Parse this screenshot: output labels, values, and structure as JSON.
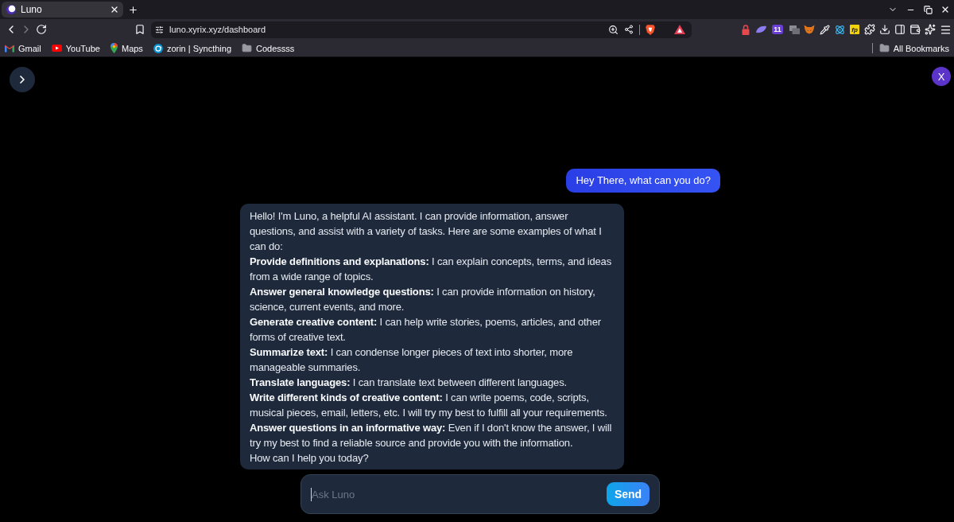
{
  "browser": {
    "tabs": [
      {
        "title": "Luno",
        "selected": true
      }
    ],
    "address": "luno.xyrix.xyz/dashboard",
    "extension_count": "11",
    "extension_label": "fp",
    "bookmarks": [
      {
        "label": "Gmail"
      },
      {
        "label": "YouTube"
      },
      {
        "label": "Maps"
      },
      {
        "label": "zorin | Syncthing"
      },
      {
        "label": "Codessss"
      }
    ],
    "all_bookmarks": "All Bookmarks"
  },
  "app": {
    "avatar": "X",
    "messages": [
      {
        "kind": "user",
        "text": "Hey There, what can you do?"
      },
      {
        "kind": "assistant",
        "paragraphs": [
          "Hello! I'm Luno, a helpful AI assistant. I can provide information, answer questions, and assist with a variety of tasks. Here are some examples of what I can do:",
          "**Provide definitions and explanations:** I can explain concepts, terms, and ideas from a wide range of topics.",
          "**Answer general knowledge questions:** I can provide information on history, science, current events, and more.",
          "**Generate creative content:** I can help write stories, poems, articles, and other forms of creative text.",
          "**Summarize text:** I can condense longer pieces of text into shorter, more manageable summaries.",
          "**Translate languages:** I can translate text between different languages.",
          "**Write different kinds of creative content:** I can write poems, code, scripts, musical pieces, email, letters, etc. I will try my best to fulfill all your requirements.",
          "**Answer questions in an informative way:** Even if I don't know the answer, I will try my best to find a reliable source and provide you with the information.",
          "How can I help you today?"
        ]
      }
    ],
    "composer": {
      "placeholder": "Ask Luno",
      "send": "Send"
    }
  }
}
